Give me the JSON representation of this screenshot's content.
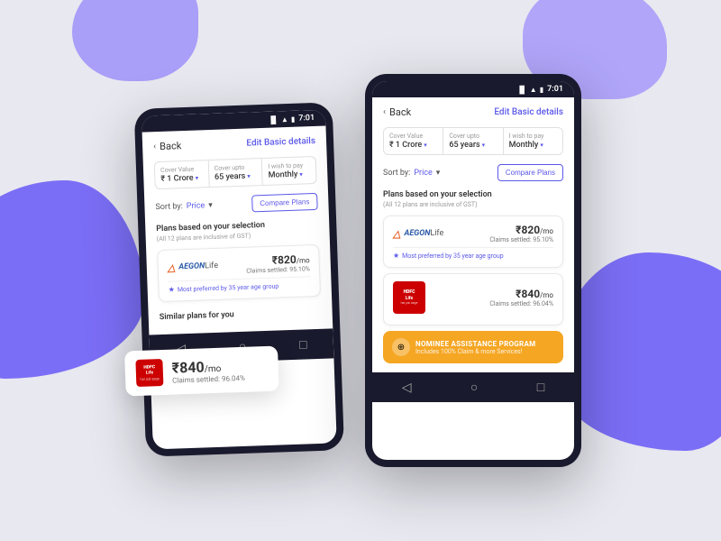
{
  "background": {
    "color": "#e8e8f0"
  },
  "phone_left": {
    "status_time": "7:01",
    "header": {
      "back_label": "Back",
      "edit_label": "Edit Basic details"
    },
    "filters": {
      "cover_value": {
        "label": "Cover Value",
        "value": "₹ 1 Crore",
        "chevron": "▾"
      },
      "cover_upto": {
        "label": "Cover upto",
        "value": "65 years",
        "chevron": "▾"
      },
      "payment": {
        "label": "I wish to pay",
        "value": "Monthly",
        "chevron": "▾"
      }
    },
    "sort": {
      "label": "Sort by:",
      "value": "Price",
      "chevron": "▾"
    },
    "compare_btn": "Compare Plans",
    "section": {
      "title": "Plans based on your selection",
      "subtitle": "(All 12 plans are inclusive of GST)"
    },
    "plan1": {
      "provider": "AEGONLife",
      "price": "₹820",
      "price_unit": "/mo",
      "claims": "Claims settled:  95.10%",
      "badge": "Most preferred by 35 year age group"
    },
    "floating_card": {
      "provider": "HDFC Life",
      "price": "₹840",
      "price_unit": "/mo",
      "claims": "Claims settled:  96.04%"
    },
    "similar_title": "Similar plans for you"
  },
  "phone_right": {
    "status_time": "7:01",
    "header": {
      "back_label": "Back",
      "edit_label": "Edit Basic details"
    },
    "filters": {
      "cover_value": {
        "label": "Cover Value",
        "value": "₹ 1 Crore",
        "chevron": "▾"
      },
      "cover_upto": {
        "label": "Cover upto",
        "value": "65 years",
        "chevron": "▾"
      },
      "payment": {
        "label": "I wish to pay",
        "value": "Monthly",
        "chevron": "▾"
      }
    },
    "sort": {
      "label": "Sort by:",
      "value": "Price",
      "chevron": "▾"
    },
    "compare_btn": "Compare Plans",
    "section": {
      "title": "Plans based on your selection",
      "subtitle": "(All 12 plans are inclusive of GST)"
    },
    "plan1": {
      "provider": "AEGONLife",
      "price": "₹820",
      "price_unit": "/mo",
      "claims": "Claims settled:  95.10%",
      "badge": "Most preferred by 35 year age group"
    },
    "plan2": {
      "provider": "HDFC Life",
      "price": "₹840",
      "price_unit": "/mo",
      "claims": "Claims settled:  96.04%"
    },
    "nominee_banner": {
      "title": "NOMINEE ASSISTANCE PROGRAM",
      "subtitle": "Includes 100% Claim & more Services!"
    }
  },
  "nav": {
    "back_icon": "◁",
    "home_icon": "○",
    "recent_icon": "□"
  }
}
